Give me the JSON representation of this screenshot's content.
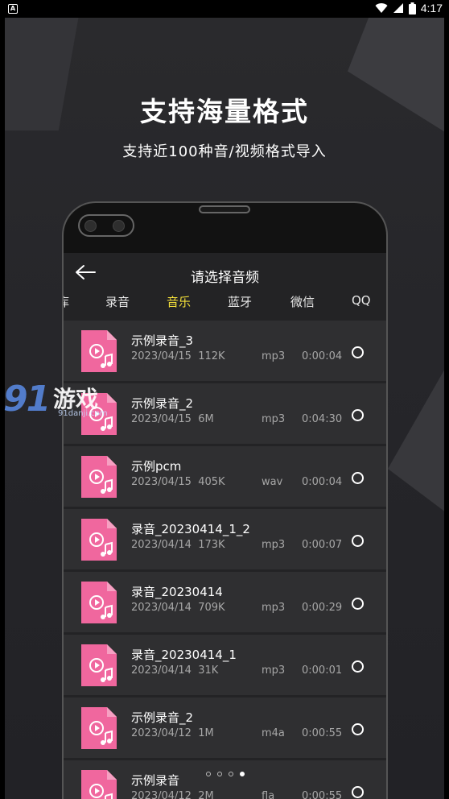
{
  "statusbar": {
    "left_badge": "A",
    "time": "4:17"
  },
  "promo": {
    "headline": "支持海量格式",
    "subline": "支持近100种音/视频格式导入"
  },
  "app": {
    "title": "请选择音频",
    "tabs": [
      {
        "label": "库"
      },
      {
        "label": "录音"
      },
      {
        "label": "音乐"
      },
      {
        "label": "蓝牙"
      },
      {
        "label": "微信"
      },
      {
        "label": "QQ"
      }
    ],
    "active_tab": "音乐",
    "files": [
      {
        "name": "示例录音_3",
        "date": "2023/04/15",
        "size": "112K",
        "format": "mp3",
        "duration": "0:00:04"
      },
      {
        "name": "示例录音_2",
        "date": "2023/04/15",
        "size": "6M",
        "format": "mp3",
        "duration": "0:04:30"
      },
      {
        "name": "示例pcm",
        "date": "2023/04/15",
        "size": "405K",
        "format": "wav",
        "duration": "0:00:04"
      },
      {
        "name": "录音_20230414_1_2",
        "date": "2023/04/14",
        "size": "173K",
        "format": "mp3",
        "duration": "0:00:07"
      },
      {
        "name": "录音_20230414",
        "date": "2023/04/14",
        "size": "709K",
        "format": "mp3",
        "duration": "0:00:29"
      },
      {
        "name": "录音_20230414_1",
        "date": "2023/04/14",
        "size": "31K",
        "format": "mp3",
        "duration": "0:00:01"
      },
      {
        "name": "示例录音_2",
        "date": "2023/04/12",
        "size": "1M",
        "format": "m4a",
        "duration": "0:00:55"
      },
      {
        "name": "示例录音",
        "date": "2023/04/12",
        "size": "2M",
        "format": "fla",
        "duration": "0:00:55"
      }
    ]
  },
  "pager": {
    "count": 4,
    "active_index": 3
  },
  "watermark": {
    "logo": "91",
    "brand": "游戏",
    "url": "91danji.com"
  },
  "colors": {
    "accent_tab": "#f3df3a",
    "file_icon": "#f0679e",
    "background": "#2a2a2d"
  }
}
